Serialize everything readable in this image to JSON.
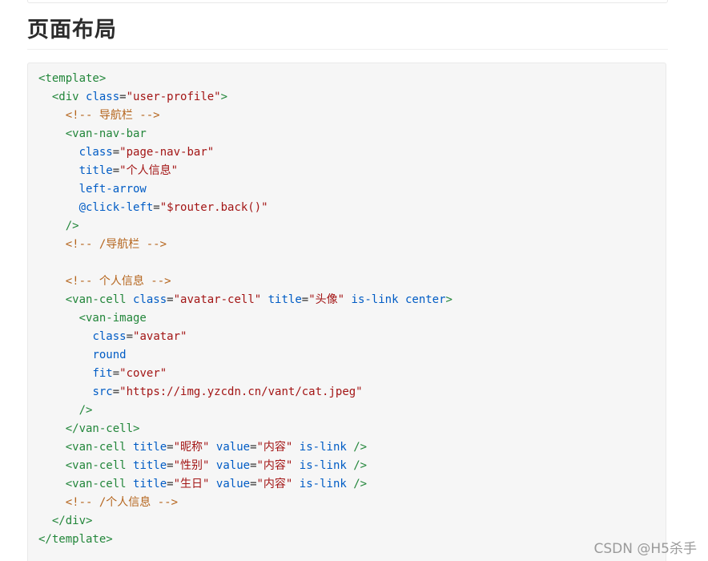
{
  "heading": "页面布局",
  "watermark": "CSDN @H5杀手",
  "code_lines": [
    [
      {
        "t": "tag",
        "v": "<template>"
      }
    ],
    [
      {
        "t": "plain",
        "v": "  "
      },
      {
        "t": "tag",
        "v": "<div"
      },
      {
        "t": "plain",
        "v": " "
      },
      {
        "t": "attr",
        "v": "class"
      },
      {
        "t": "punct",
        "v": "="
      },
      {
        "t": "str",
        "v": "\"user-profile\""
      },
      {
        "t": "tag",
        "v": ">"
      }
    ],
    [
      {
        "t": "plain",
        "v": "    "
      },
      {
        "t": "comment",
        "v": "<!-- 导航栏 -->"
      }
    ],
    [
      {
        "t": "plain",
        "v": "    "
      },
      {
        "t": "tag",
        "v": "<van-nav-bar"
      }
    ],
    [
      {
        "t": "plain",
        "v": "      "
      },
      {
        "t": "attr",
        "v": "class"
      },
      {
        "t": "punct",
        "v": "="
      },
      {
        "t": "str",
        "v": "\"page-nav-bar\""
      }
    ],
    [
      {
        "t": "plain",
        "v": "      "
      },
      {
        "t": "attr",
        "v": "title"
      },
      {
        "t": "punct",
        "v": "="
      },
      {
        "t": "str",
        "v": "\"个人信息\""
      }
    ],
    [
      {
        "t": "plain",
        "v": "      "
      },
      {
        "t": "attr",
        "v": "left-arrow"
      }
    ],
    [
      {
        "t": "plain",
        "v": "      "
      },
      {
        "t": "attr",
        "v": "@click-left"
      },
      {
        "t": "punct",
        "v": "="
      },
      {
        "t": "str",
        "v": "\"$router.back()\""
      }
    ],
    [
      {
        "t": "plain",
        "v": "    "
      },
      {
        "t": "tag",
        "v": "/>"
      }
    ],
    [
      {
        "t": "plain",
        "v": "    "
      },
      {
        "t": "comment",
        "v": "<!-- /导航栏 -->"
      }
    ],
    [
      {
        "t": "plain",
        "v": ""
      }
    ],
    [
      {
        "t": "plain",
        "v": "    "
      },
      {
        "t": "comment",
        "v": "<!-- 个人信息 -->"
      }
    ],
    [
      {
        "t": "plain",
        "v": "    "
      },
      {
        "t": "tag",
        "v": "<van-cell"
      },
      {
        "t": "plain",
        "v": " "
      },
      {
        "t": "attr",
        "v": "class"
      },
      {
        "t": "punct",
        "v": "="
      },
      {
        "t": "str",
        "v": "\"avatar-cell\""
      },
      {
        "t": "plain",
        "v": " "
      },
      {
        "t": "attr",
        "v": "title"
      },
      {
        "t": "punct",
        "v": "="
      },
      {
        "t": "str",
        "v": "\"头像\""
      },
      {
        "t": "plain",
        "v": " "
      },
      {
        "t": "attr",
        "v": "is-link"
      },
      {
        "t": "plain",
        "v": " "
      },
      {
        "t": "attr",
        "v": "center"
      },
      {
        "t": "tag",
        "v": ">"
      }
    ],
    [
      {
        "t": "plain",
        "v": "      "
      },
      {
        "t": "tag",
        "v": "<van-image"
      }
    ],
    [
      {
        "t": "plain",
        "v": "        "
      },
      {
        "t": "attr",
        "v": "class"
      },
      {
        "t": "punct",
        "v": "="
      },
      {
        "t": "str",
        "v": "\"avatar\""
      }
    ],
    [
      {
        "t": "plain",
        "v": "        "
      },
      {
        "t": "attr",
        "v": "round"
      }
    ],
    [
      {
        "t": "plain",
        "v": "        "
      },
      {
        "t": "attr",
        "v": "fit"
      },
      {
        "t": "punct",
        "v": "="
      },
      {
        "t": "str",
        "v": "\"cover\""
      }
    ],
    [
      {
        "t": "plain",
        "v": "        "
      },
      {
        "t": "attr",
        "v": "src"
      },
      {
        "t": "punct",
        "v": "="
      },
      {
        "t": "str",
        "v": "\"https://img.yzcdn.cn/vant/cat.jpeg\""
      }
    ],
    [
      {
        "t": "plain",
        "v": "      "
      },
      {
        "t": "tag",
        "v": "/>"
      }
    ],
    [
      {
        "t": "plain",
        "v": "    "
      },
      {
        "t": "tag",
        "v": "</van-cell>"
      }
    ],
    [
      {
        "t": "plain",
        "v": "    "
      },
      {
        "t": "tag",
        "v": "<van-cell"
      },
      {
        "t": "plain",
        "v": " "
      },
      {
        "t": "attr",
        "v": "title"
      },
      {
        "t": "punct",
        "v": "="
      },
      {
        "t": "str",
        "v": "\"昵称\""
      },
      {
        "t": "plain",
        "v": " "
      },
      {
        "t": "attr",
        "v": "value"
      },
      {
        "t": "punct",
        "v": "="
      },
      {
        "t": "str",
        "v": "\"内容\""
      },
      {
        "t": "plain",
        "v": " "
      },
      {
        "t": "attr",
        "v": "is-link"
      },
      {
        "t": "plain",
        "v": " "
      },
      {
        "t": "tag",
        "v": "/>"
      }
    ],
    [
      {
        "t": "plain",
        "v": "    "
      },
      {
        "t": "tag",
        "v": "<van-cell"
      },
      {
        "t": "plain",
        "v": " "
      },
      {
        "t": "attr",
        "v": "title"
      },
      {
        "t": "punct",
        "v": "="
      },
      {
        "t": "str",
        "v": "\"性别\""
      },
      {
        "t": "plain",
        "v": " "
      },
      {
        "t": "attr",
        "v": "value"
      },
      {
        "t": "punct",
        "v": "="
      },
      {
        "t": "str",
        "v": "\"内容\""
      },
      {
        "t": "plain",
        "v": " "
      },
      {
        "t": "attr",
        "v": "is-link"
      },
      {
        "t": "plain",
        "v": " "
      },
      {
        "t": "tag",
        "v": "/>"
      }
    ],
    [
      {
        "t": "plain",
        "v": "    "
      },
      {
        "t": "tag",
        "v": "<van-cell"
      },
      {
        "t": "plain",
        "v": " "
      },
      {
        "t": "attr",
        "v": "title"
      },
      {
        "t": "punct",
        "v": "="
      },
      {
        "t": "str",
        "v": "\"生日\""
      },
      {
        "t": "plain",
        "v": " "
      },
      {
        "t": "attr",
        "v": "value"
      },
      {
        "t": "punct",
        "v": "="
      },
      {
        "t": "str",
        "v": "\"内容\""
      },
      {
        "t": "plain",
        "v": " "
      },
      {
        "t": "attr",
        "v": "is-link"
      },
      {
        "t": "plain",
        "v": " "
      },
      {
        "t": "tag",
        "v": "/>"
      }
    ],
    [
      {
        "t": "plain",
        "v": "    "
      },
      {
        "t": "comment",
        "v": "<!-- /个人信息 -->"
      }
    ],
    [
      {
        "t": "plain",
        "v": "  "
      },
      {
        "t": "tag",
        "v": "</div>"
      }
    ],
    [
      {
        "t": "tag",
        "v": "</template>"
      }
    ]
  ]
}
